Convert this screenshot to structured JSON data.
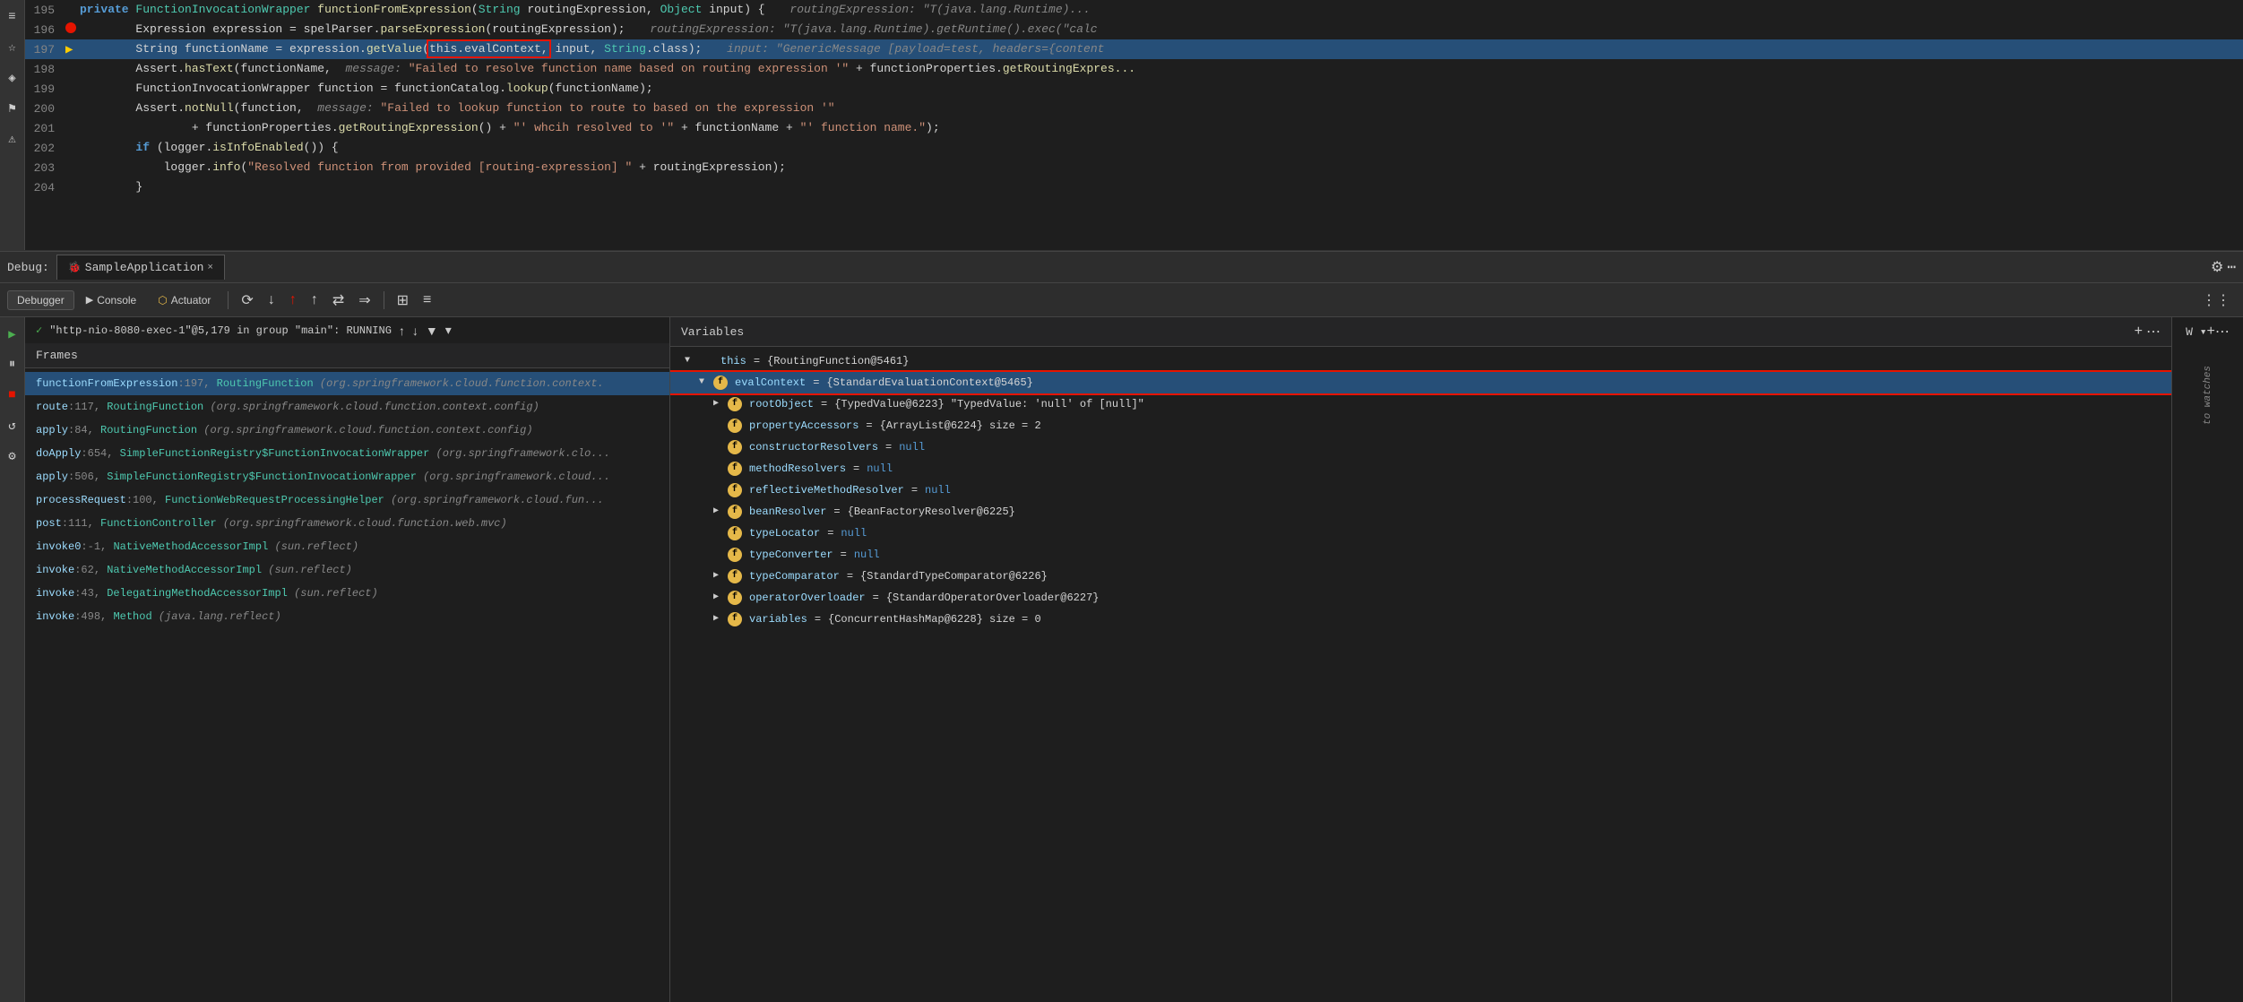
{
  "code": {
    "lines": [
      {
        "num": "195",
        "marker": "",
        "content_parts": [
          {
            "text": "    ",
            "cls": ""
          },
          {
            "text": "private",
            "cls": "kw"
          },
          {
            "text": " ",
            "cls": ""
          },
          {
            "text": "FunctionInvocationWrapper",
            "cls": "kw-type"
          },
          {
            "text": " ",
            "cls": ""
          },
          {
            "text": "functionFromExpression",
            "cls": "method"
          },
          {
            "text": "(",
            "cls": "punct"
          },
          {
            "text": "String",
            "cls": "kw-type"
          },
          {
            "text": " routingExpression, ",
            "cls": ""
          },
          {
            "text": "Object",
            "cls": "kw-type"
          },
          {
            "text": " input) {",
            "cls": ""
          }
        ],
        "hint": "routingExpression: \"T(java.lang.Runtime)...",
        "highlight": false,
        "breakpoint": false,
        "execution": false
      },
      {
        "num": "196",
        "marker": "breakpoint",
        "content_parts": [
          {
            "text": "        Expression expression = spelParser.",
            "cls": ""
          },
          {
            "text": "parseExpression",
            "cls": "method"
          },
          {
            "text": "(routingExpression);",
            "cls": ""
          }
        ],
        "hint": "routingExpression: \"T(java.lang.Runtime).getRuntime().exec(\"calc",
        "highlight": false,
        "breakpoint": true,
        "execution": false
      },
      {
        "num": "197",
        "marker": "execution",
        "content_parts": [
          {
            "text": "        String functionName = expression.",
            "cls": ""
          },
          {
            "text": "getValue",
            "cls": "method"
          },
          {
            "text": "(",
            "cls": ""
          },
          {
            "text": "this.evalContext,",
            "cls": "red_box"
          },
          {
            "text": " input, ",
            "cls": ""
          },
          {
            "text": "String",
            "cls": "kw-type"
          },
          {
            "text": ".class);",
            "cls": ""
          }
        ],
        "hint": "input: \"GenericMessage [payload=test, headers={content",
        "highlight": true,
        "breakpoint": false,
        "execution": true
      },
      {
        "num": "198",
        "marker": "",
        "content_parts": [
          {
            "text": "        Assert.",
            "cls": ""
          },
          {
            "text": "hasText",
            "cls": "method"
          },
          {
            "text": "(functionName,  ",
            "cls": ""
          },
          {
            "text": "message:",
            "cls": "italic-grey"
          },
          {
            "text": " ",
            "cls": ""
          },
          {
            "text": "\"Failed to resolve function name ",
            "cls": "str"
          },
          {
            "text": "based",
            "cls": "str"
          },
          {
            "text": " on routing expression '\"",
            "cls": "str"
          },
          {
            "text": " + functionProperties.",
            "cls": ""
          },
          {
            "text": "getRoutingExpres...",
            "cls": "method"
          }
        ],
        "hint": "",
        "highlight": false,
        "breakpoint": false,
        "execution": false
      },
      {
        "num": "199",
        "marker": "",
        "content_parts": [
          {
            "text": "        FunctionInvocationWrapper function = functionCatalog.",
            "cls": ""
          },
          {
            "text": "lookup",
            "cls": "method"
          },
          {
            "text": "(functionName);",
            "cls": ""
          }
        ],
        "hint": "",
        "highlight": false,
        "breakpoint": false,
        "execution": false
      },
      {
        "num": "200",
        "marker": "",
        "content_parts": [
          {
            "text": "        Assert.",
            "cls": ""
          },
          {
            "text": "notNull",
            "cls": "method"
          },
          {
            "text": "(function,  ",
            "cls": ""
          },
          {
            "text": "message:",
            "cls": "italic-grey"
          },
          {
            "text": " ",
            "cls": ""
          },
          {
            "text": "\"Failed to lookup function to route to ",
            "cls": "str"
          },
          {
            "text": "based",
            "cls": "str"
          },
          {
            "text": " on the expression '\"",
            "cls": "str"
          }
        ],
        "hint": "",
        "highlight": false,
        "breakpoint": false,
        "execution": false
      },
      {
        "num": "201",
        "marker": "",
        "content_parts": [
          {
            "text": "                + functionProperties.",
            "cls": ""
          },
          {
            "text": "getRoutingExpression",
            "cls": "method"
          },
          {
            "text": "() + \"' whcih resolved ",
            "cls": "str"
          },
          {
            "text": "to",
            "cls": "str"
          },
          {
            "text": " '\" + functionName + \"' function name.\");",
            "cls": "str"
          }
        ],
        "hint": "",
        "highlight": false,
        "breakpoint": false,
        "execution": false
      },
      {
        "num": "202",
        "marker": "",
        "content_parts": [
          {
            "text": "        ",
            "cls": ""
          },
          {
            "text": "if",
            "cls": "kw"
          },
          {
            "text": " (logger.",
            "cls": ""
          },
          {
            "text": "isInfoEnabled",
            "cls": "method"
          },
          {
            "text": "()) {",
            "cls": ""
          }
        ],
        "hint": "",
        "highlight": false,
        "breakpoint": false,
        "execution": false
      },
      {
        "num": "203",
        "marker": "",
        "content_parts": [
          {
            "text": "            logger.",
            "cls": ""
          },
          {
            "text": "info",
            "cls": "method"
          },
          {
            "text": "(\"Resolved function from provided [routing-expression]  \" + routingExpression);",
            "cls": ""
          }
        ],
        "hint": "",
        "highlight": false,
        "breakpoint": false,
        "execution": false
      },
      {
        "num": "204",
        "marker": "",
        "content_parts": [
          {
            "text": "        }",
            "cls": ""
          }
        ],
        "hint": "",
        "highlight": false,
        "breakpoint": false,
        "execution": false
      }
    ]
  },
  "debug_bar": {
    "label": "Debug:",
    "tab_name": "SampleApplication",
    "close": "×"
  },
  "toolbar": {
    "tabs": [
      "Debugger",
      "Console",
      "Actuator"
    ],
    "active_tab": "Debugger"
  },
  "frames_panel": {
    "header": "Frames",
    "thread": "\"http-nio-8080-exec-1\"@5,179 in group \"main\": RUNNING",
    "items": [
      {
        "text": "functionFromExpression:197, RoutingFunction (org.springframework.cloud.function.context.",
        "active": true,
        "check": false
      },
      {
        "text": "route:117, RoutingFunction (org.springframework.cloud.function.context.config)",
        "active": false,
        "check": false
      },
      {
        "text": "apply:84, RoutingFunction (org.springframework.cloud.function.context.config)",
        "active": false,
        "check": false
      },
      {
        "text": "doApply:654, SimpleFunctionRegistry$FunctionInvocationWrapper (org.springframework.clo...",
        "active": false,
        "check": false
      },
      {
        "text": "apply:506, SimpleFunctionRegistry$FunctionInvocationWrapper (org.springframework.cloud...",
        "active": false,
        "check": false
      },
      {
        "text": "processRequest:100, FunctionWebRequestProcessingHelper (org.springframework.cloud.fun...",
        "active": false,
        "check": false
      },
      {
        "text": "post:111, FunctionController (org.springframework.cloud.function.web.mvc)",
        "active": false,
        "check": false
      },
      {
        "text": "invoke0:-1, NativeMethodAccessorImpl (sun.reflect)",
        "active": false,
        "check": false
      },
      {
        "text": "invoke:62, NativeMethodAccessorImpl (sun.reflect)",
        "active": false,
        "check": false
      },
      {
        "text": "invoke:43, DelegatingMethodAccessorImpl (sun.reflect)",
        "active": false,
        "check": false
      },
      {
        "text": "invoke:498, Method (java.lang.reflect)",
        "active": false,
        "check": false
      }
    ]
  },
  "variables_panel": {
    "header": "Variables",
    "items": [
      {
        "indent": 0,
        "expanded": true,
        "has_arrow": true,
        "has_f": false,
        "name": "this",
        "eq": "=",
        "value": "{RoutingFunction@5461}",
        "value_cls": "var-value",
        "highlighted": false
      },
      {
        "indent": 1,
        "expanded": true,
        "has_arrow": true,
        "has_f": true,
        "name": "evalContext",
        "eq": "=",
        "value": "{StandardEvaluationContext@5465}",
        "value_cls": "var-value",
        "highlighted": true,
        "red_outline": true
      },
      {
        "indent": 2,
        "expanded": false,
        "has_arrow": true,
        "has_f": true,
        "name": "rootObject",
        "eq": "=",
        "value": "{TypedValue@6223} \"TypedValue: 'null' of [null]\"",
        "value_cls": "var-value",
        "highlighted": false
      },
      {
        "indent": 2,
        "expanded": false,
        "has_arrow": false,
        "has_f": true,
        "name": "propertyAccessors",
        "eq": "=",
        "value": "{ArrayList@6224}  size = 2",
        "value_cls": "var-value",
        "highlighted": false
      },
      {
        "indent": 2,
        "expanded": false,
        "has_arrow": false,
        "has_f": true,
        "name": "constructorResolvers",
        "eq": "=",
        "value": "null",
        "value_cls": "var-null",
        "highlighted": false
      },
      {
        "indent": 2,
        "expanded": false,
        "has_arrow": false,
        "has_f": true,
        "name": "methodResolvers",
        "eq": "=",
        "value": "null",
        "value_cls": "var-null",
        "highlighted": false
      },
      {
        "indent": 2,
        "expanded": false,
        "has_arrow": false,
        "has_f": true,
        "name": "reflectiveMethodResolver",
        "eq": "=",
        "value": "null",
        "value_cls": "var-null",
        "highlighted": false
      },
      {
        "indent": 2,
        "expanded": false,
        "has_arrow": true,
        "has_f": true,
        "name": "beanResolver",
        "eq": "=",
        "value": "{BeanFactoryResolver@6225}",
        "value_cls": "var-value",
        "highlighted": false
      },
      {
        "indent": 2,
        "expanded": false,
        "has_arrow": false,
        "has_f": true,
        "name": "typeLocator",
        "eq": "=",
        "value": "null",
        "value_cls": "var-null",
        "highlighted": false
      },
      {
        "indent": 2,
        "expanded": false,
        "has_arrow": false,
        "has_f": true,
        "name": "typeConverter",
        "eq": "=",
        "value": "null",
        "value_cls": "var-null",
        "highlighted": false
      },
      {
        "indent": 2,
        "expanded": false,
        "has_arrow": true,
        "has_f": true,
        "name": "typeComparator",
        "eq": "=",
        "value": "{StandardTypeComparator@6226}",
        "value_cls": "var-value",
        "highlighted": false
      },
      {
        "indent": 2,
        "expanded": false,
        "has_arrow": true,
        "has_f": true,
        "name": "operatorOverloader",
        "eq": "=",
        "value": "{StandardOperatorOverloader@6227}",
        "value_cls": "var-value",
        "highlighted": false
      },
      {
        "indent": 2,
        "expanded": false,
        "has_arrow": true,
        "has_f": true,
        "name": "variables",
        "eq": "=",
        "value": "{ConcurrentHashMap@6228}  size = 0",
        "value_cls": "var-value",
        "highlighted": false
      }
    ]
  },
  "watch_label": "W ▾",
  "no_watches": "to watches"
}
